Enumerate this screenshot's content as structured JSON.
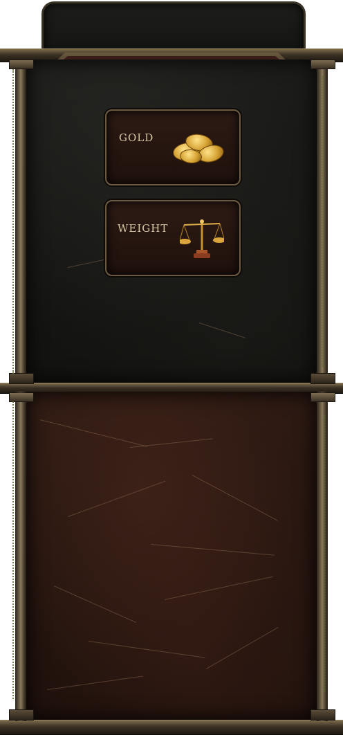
{
  "inventory": {
    "stats": {
      "gold": {
        "label": "GOLD",
        "icon": "gold-coins-icon"
      },
      "weight": {
        "label": "WEIGHT",
        "icon": "balance-scale-icon"
      }
    }
  },
  "theme": {
    "frame": "#6b5d45",
    "panel_top": "#1c1c1a",
    "panel_bottom": "#2e1a13",
    "label_text": "#d8c9a6",
    "vine": "#5d6b2f"
  }
}
